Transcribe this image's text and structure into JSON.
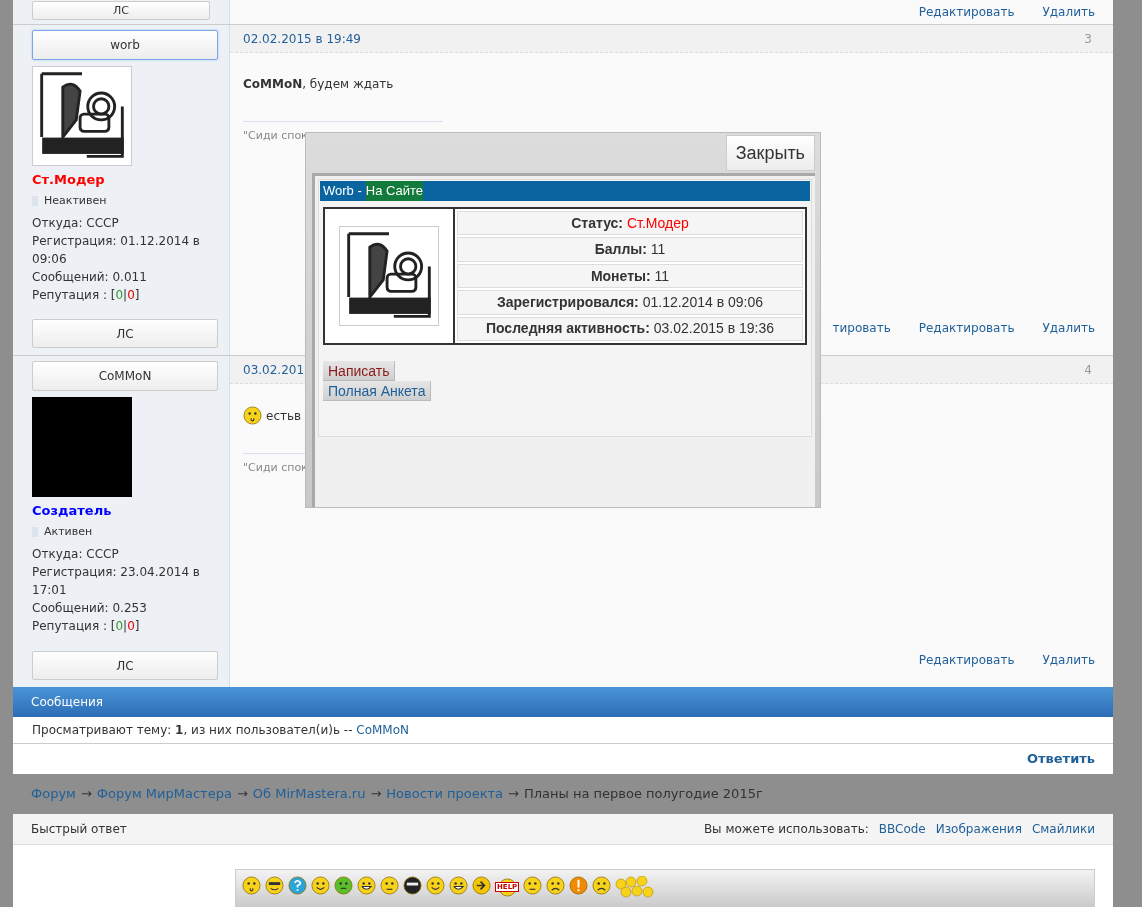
{
  "previous_post": {
    "pm_button": "ЛС",
    "actions": [
      "Редактировать",
      "Удалить"
    ]
  },
  "posts": [
    {
      "author": {
        "name": "worb",
        "selected": true,
        "avatar": {
          "kind": "logo"
        },
        "rank": "Ст.Модер",
        "color": "#ff0000",
        "status": "Неактивен",
        "from": "Откуда: СССР",
        "registered": "Регистрация: 01.12.2014 в 09:06",
        "messages": "Сообщений: 0.011",
        "reputation": {
          "label": "Репутация :",
          "open": "[",
          "plus": "0",
          "sep": "|",
          "minus": "0",
          "close": "]"
        },
        "pm_button": "ЛС"
      },
      "date": "02.02.2015 в 19:49",
      "number": "3",
      "smiley": false,
      "body": "**CoMMoN**, будем ждать",
      "signature": "\"Сиди спок",
      "actions": [
        "тировать",
        "Редактировать",
        "Удалить"
      ]
    },
    {
      "author": {
        "name": "CoMMoN",
        "selected": false,
        "avatar": {
          "kind": "dark"
        },
        "rank": "Создатель",
        "color": "#0000ff",
        "status": "Активен",
        "from": "Откуда: СССР",
        "registered": "Регистрация: 23.04.2014 в 17:01",
        "messages": "Сообщений: 0.253",
        "reputation": {
          "label": "Репутация :",
          "open": "[",
          "plus": "0",
          "sep": "|",
          "minus": "0",
          "close": "]"
        },
        "pm_button": "ЛС"
      },
      "date": "03.02.201",
      "number": "4",
      "smiley": true,
      "body": "естьв",
      "signature": "\"Сиди спок",
      "actions": [
        "Редактировать",
        "Удалить"
      ]
    }
  ],
  "messages_bar": {
    "title": "Сообщения",
    "viewers": "Просматривают тему: **1**, из них пользовател(и)ь -- ",
    "viewer_link": "CoMMoN",
    "reply_link": "Ответить"
  },
  "breadcrumb": {
    "separator": "→",
    "items": [
      {
        "label": "Форум",
        "kind": "link"
      },
      {
        "label": "Форум МирМастера",
        "kind": "link"
      },
      {
        "label": "Об MirMastera.ru",
        "kind": "link"
      },
      {
        "label": "Новости проекта",
        "kind": "link"
      },
      {
        "label": "Планы на первое полугодие 2015г",
        "kind": "current"
      }
    ]
  },
  "quick_reply": {
    "title": "Быстрый ответ",
    "hint": "Вы можете использовать:",
    "links": [
      "BBCode",
      "Изображения",
      "Смайлики"
    ],
    "smileys": [
      {
        "kind": "surprised"
      },
      {
        "kind": "cool"
      },
      {
        "kind": "question"
      },
      {
        "kind": "smile"
      },
      {
        "kind": "sick"
      },
      {
        "kind": "grin"
      },
      {
        "kind": "rolleyes"
      },
      {
        "kind": "ninja"
      },
      {
        "kind": "wink"
      },
      {
        "kind": "laugh"
      },
      {
        "kind": "arrow"
      },
      {
        "kind": "help",
        "sign": "HELP"
      },
      {
        "kind": "hmm"
      },
      {
        "kind": "cry"
      },
      {
        "kind": "warning"
      },
      {
        "kind": "sad"
      },
      {
        "kind": "group"
      }
    ]
  },
  "popup": {
    "close_button": "Закрыть",
    "title": "Worb -",
    "status": "На Сайте",
    "online": true,
    "rows": [
      {
        "label": "Статус:",
        "value": "Ст.Модер",
        "kind": "role"
      },
      {
        "label": "Баллы:",
        "value": "11",
        "kind": "plain"
      },
      {
        "label": "Монеты:",
        "value": "11",
        "kind": "plain"
      },
      {
        "label": "Зарегистрировался:",
        "value": "01.12.2014 в 09:06",
        "kind": "plain"
      },
      {
        "label": "Последняя активность:",
        "value": "03.02.2015 в 19:36",
        "kind": "plain"
      }
    ],
    "buttons": [
      {
        "label": "Написать",
        "kind": "write"
      },
      {
        "label": "Полная Анкета",
        "kind": "profile"
      }
    ]
  }
}
